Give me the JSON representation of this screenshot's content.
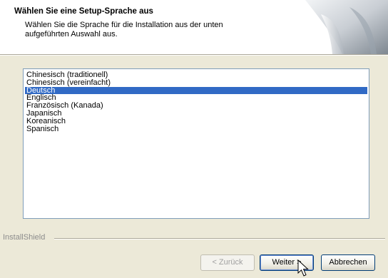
{
  "header": {
    "title": "Wählen Sie eine Setup-Sprache aus",
    "description": "Wählen Sie die Sprache für die Installation aus der unten aufgeführten Auswahl aus."
  },
  "languages": {
    "items": [
      "Chinesisch (traditionell)",
      "Chinesisch (vereinfacht)",
      "Deutsch",
      "Englisch",
      "Französisch (Kanada)",
      "Japanisch",
      "Koreanisch",
      "Spanisch"
    ],
    "selected": "Deutsch"
  },
  "footer": {
    "brand": "InstallShield"
  },
  "buttons": {
    "back": "< Zurück",
    "next": "Weiter >",
    "cancel": "Abbrechen"
  },
  "colors": {
    "selection": "#316ac5",
    "dialog_background": "#ece9d8"
  }
}
